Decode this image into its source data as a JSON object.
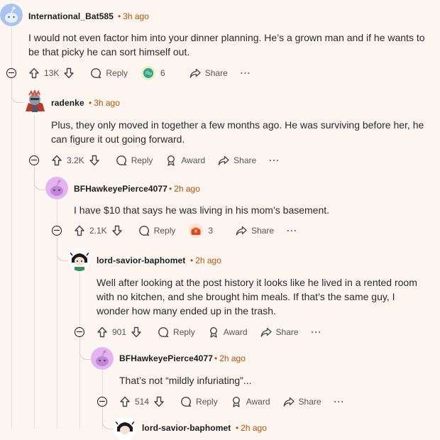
{
  "comments": [
    {
      "author": "International_Bat585",
      "time": "3h ago",
      "text": "I would not even factor him into your dinner planning. He’s a grown man and if he wants to be that picky he can sort himself out.",
      "votes": "13K",
      "reply_label": "Reply",
      "award_count": "6",
      "share_label": "Share",
      "avatar": "snoo-blue-avatar"
    },
    {
      "author": "radenke",
      "time": "3h ago",
      "text": "Plus, they only moved in together a few months ago. He was surviving before her, he can figure it out going forward.",
      "votes": "3.2K",
      "reply_label": "Reply",
      "award_label": "Award",
      "share_label": "Share",
      "avatar": "custom-avatar-knight"
    },
    {
      "author": "BFHawkeyePierce4077",
      "time": "2h ago",
      "text": "I have $10 that says he was living in his mom’s basement.",
      "votes": "2.1K",
      "reply_label": "Reply",
      "award_count": "3",
      "share_label": "Share",
      "avatar": "snoo-purple-avatar"
    },
    {
      "author": "lord-savior-baphomet",
      "time": "2h ago",
      "text": "Well after looking at the post history it looks like he lived in a rented room with no kitchen, and she brought him meals. If that’s the same guy, I wonder how many ended up in the trash.",
      "votes": "901",
      "reply_label": "Reply",
      "award_label": "Award",
      "share_label": "Share",
      "avatar": "custom-avatar-baphomet"
    },
    {
      "author": "BFHawkeyePierce4077",
      "time": "2h ago",
      "text": "That’s not “mildly infuriating”...",
      "votes": "514",
      "reply_label": "Reply",
      "award_label": "Award",
      "share_label": "Share",
      "avatar": "snoo-purple-avatar"
    },
    {
      "author": "lord-savior-baphomet",
      "time": "2h ago",
      "avatar": "custom-avatar-baphomet"
    }
  ],
  "colors": {
    "background": "#fdf5ef",
    "timestamp": "#b45309",
    "threadline": "#e6ded6"
  }
}
